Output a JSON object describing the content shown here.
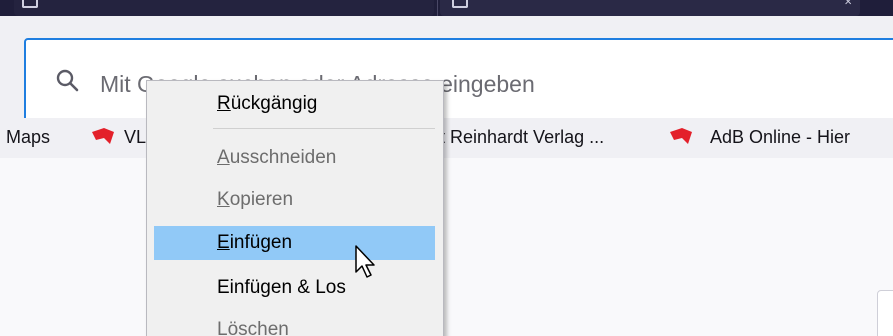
{
  "url_bar": {
    "placeholder": "Mit Google suchen oder Adresse eingeben"
  },
  "bookmarks": {
    "items": [
      {
        "label": "Maps",
        "icon": "maps-icon"
      },
      {
        "label": "VL",
        "icon": "red-bookmark-icon"
      },
      {
        "label": "t Reinhardt Verlag ...",
        "icon": ""
      },
      {
        "label": "AdB Online - Hier",
        "icon": "red-bookmark-icon"
      }
    ]
  },
  "context_menu": {
    "items": [
      {
        "id": "undo",
        "label_pre": "",
        "accel": "R",
        "label_post": "ückgängig",
        "state": "enabled"
      },
      {
        "id": "cut",
        "label_pre": "",
        "accel": "A",
        "label_post": "usschneiden",
        "state": "disabled"
      },
      {
        "id": "copy",
        "label_pre": "",
        "accel": "K",
        "label_post": "opieren",
        "state": "disabled"
      },
      {
        "id": "paste",
        "label_pre": "",
        "accel": "E",
        "label_post": "infügen",
        "state": "highlighted"
      },
      {
        "id": "paste-go",
        "label": "Einfügen & Los",
        "state": "enabled"
      },
      {
        "id": "delete",
        "label_pre": "",
        "accel": "L",
        "label_post": "öschen",
        "state": "disabled"
      }
    ]
  },
  "colors": {
    "accent_focus": "#1f7ee0",
    "menu_highlight": "#91c9f7",
    "bookmark_red": "#e3202a",
    "tabstrip": "#1f1e3a"
  }
}
